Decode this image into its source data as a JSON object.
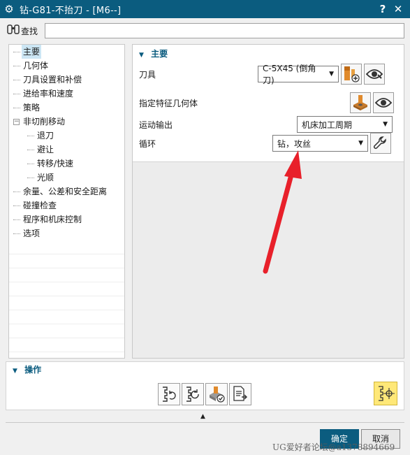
{
  "window": {
    "title": "钻-G81-不抬刀 - [M6--]",
    "help_label": "?",
    "close_label": "✕"
  },
  "search": {
    "label": "查找",
    "value": ""
  },
  "tree": {
    "items": [
      {
        "label": "主要",
        "level": 0,
        "selected": true
      },
      {
        "label": "几何体",
        "level": 0
      },
      {
        "label": "刀具设置和补偿",
        "level": 0
      },
      {
        "label": "进给率和速度",
        "level": 0
      },
      {
        "label": "策略",
        "level": 0
      },
      {
        "label": "非切削移动",
        "level": 0,
        "expander": "−"
      },
      {
        "label": "退刀",
        "level": 1
      },
      {
        "label": "避让",
        "level": 1
      },
      {
        "label": "转移/快速",
        "level": 1
      },
      {
        "label": "光顺",
        "level": 1
      },
      {
        "label": "余量、公差和安全距离",
        "level": 0
      },
      {
        "label": "碰撞检查",
        "level": 0
      },
      {
        "label": "程序和机床控制",
        "level": 0
      },
      {
        "label": "选项",
        "level": 0
      }
    ]
  },
  "main_group": {
    "header": "主要",
    "tool_label": "刀具",
    "tool_value": "C-5X45 (倒角刀)",
    "feature_geometry_label": "指定特征几何体",
    "motion_output_label": "运动输出",
    "motion_output_value": "机床加工周期",
    "cycle_label": "循环",
    "cycle_value": "钻，攻丝"
  },
  "operations": {
    "header": "操作"
  },
  "footer": {
    "ok_label": "确定",
    "cancel_label": "取消"
  },
  "watermark": "UG爱好者论坛@a1378894669",
  "colors": {
    "title_bar": "#0b5c7f",
    "arrow": "#e8202a",
    "generate_button": "#ffe878"
  },
  "icons": {
    "title": "gear-icon",
    "search": "binoculars-icon",
    "tool_new": "new-tool-icon",
    "display": "eye-icon",
    "feature_geometry": "feature-geometry-icon",
    "cycle_edit": "wrench-icon",
    "ops": [
      "regenerate-icon",
      "replay-icon",
      "verify-icon",
      "list-icon"
    ],
    "generate": "generate-icon"
  }
}
